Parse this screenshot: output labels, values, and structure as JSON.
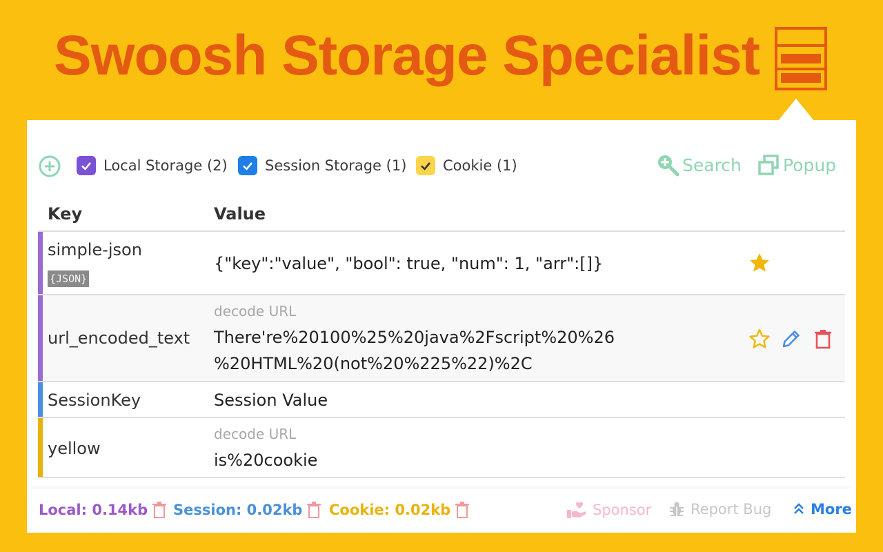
{
  "hero": {
    "title": "Swoosh Storage Specialist"
  },
  "filters": [
    {
      "label": "Local Storage (2)",
      "checked": true,
      "color": "#7B52D6"
    },
    {
      "label": "Session Storage (1)",
      "checked": true,
      "color": "#1E7FE6"
    },
    {
      "label": "Cookie (1)",
      "checked": true,
      "color": "#FCD54B"
    }
  ],
  "toolbar": {
    "search_label": "Search",
    "popup_label": "Popup"
  },
  "table": {
    "headers": {
      "key": "Key",
      "value": "Value"
    },
    "rows": [
      {
        "key": "simple-json",
        "tag": "{JSON}",
        "value": "{\"key\":\"value\", \"bool\": true, \"num\": 1, \"arr\":[]}",
        "type": "local",
        "bar_color": "#9A6BD4",
        "starred": true
      },
      {
        "key": "url_encoded_text",
        "hint": "decode URL",
        "value_line1": "There're%20100%25%20java%2Fscript%20%26",
        "value_line2": "%20HTML%20(not%20%225%22)%2C",
        "type": "local",
        "bar_color": "#9A6BD4",
        "starred": false
      },
      {
        "key": "SessionKey",
        "value": "Session Value",
        "type": "session",
        "bar_color": "#4A90E2"
      },
      {
        "key": "yellow",
        "hint": "decode URL",
        "value": "is%20cookie",
        "type": "cookie",
        "bar_color": "#E8B20C"
      }
    ]
  },
  "footer": {
    "local": {
      "label": "Local: 0.14kb",
      "color": "#9B59C8"
    },
    "session": {
      "label": "Session: 0.02kb",
      "color": "#4A90D9"
    },
    "cookie": {
      "label": "Cookie: 0.02kb",
      "color": "#E8B30C"
    },
    "sponsor_label": "Sponsor",
    "report_label": "Report Bug",
    "more_label": "More"
  },
  "colors": {
    "accent_orange": "#E55A12",
    "background": "#FBBF0F",
    "star": "#F2B705",
    "edit": "#4A90E2",
    "delete": "#E8525B",
    "search_green": "#8FD6B2"
  }
}
